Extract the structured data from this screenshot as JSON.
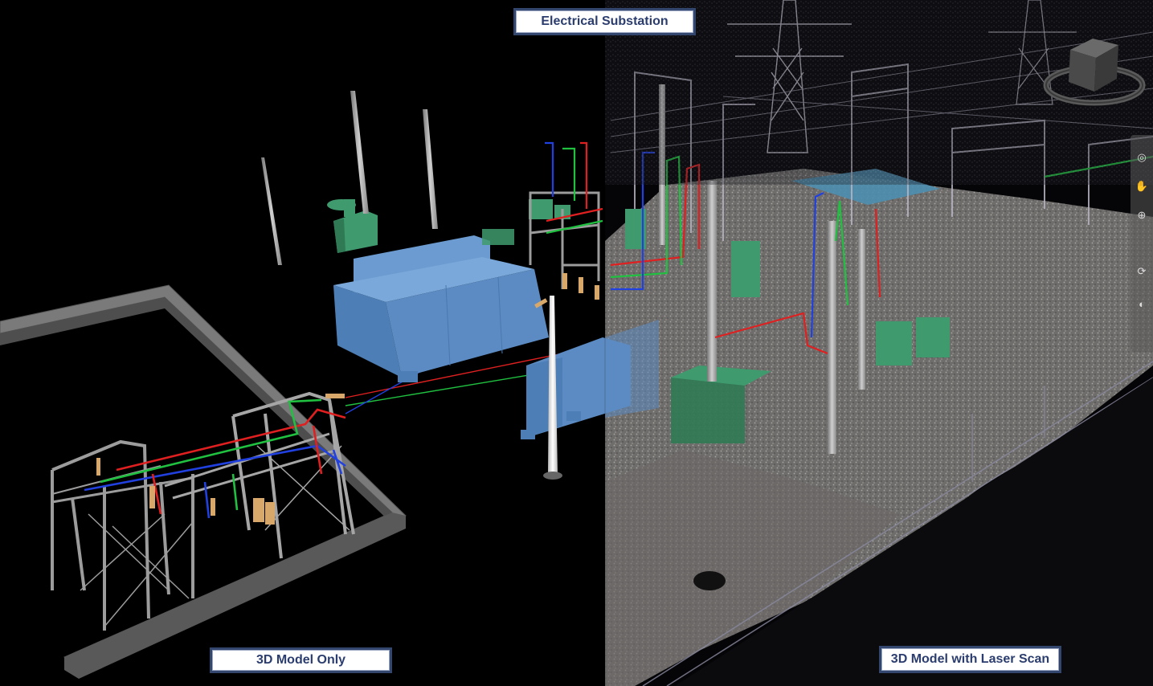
{
  "title": "Electrical Substation",
  "left_caption": "3D Model Only",
  "right_caption": "3D Model with Laser Scan",
  "colors": {
    "background": "#000000",
    "label_text": "#2b3d6e",
    "label_border": "#33476e",
    "building_blue": "#5b8bc2",
    "equipment_green": "#3f9b6e",
    "steel_gray": "#9a9a9a",
    "wire_red": "#e02020",
    "wire_green": "#20c040",
    "wire_blue": "#2040e0",
    "ground_scan": "#7c7a78"
  },
  "navigation": {
    "viewcube": "viewcube-icon",
    "tools": [
      "full-navigation-wheel-icon",
      "pan-icon",
      "zoom-icon",
      "orbit-icon",
      "look-icon"
    ]
  }
}
